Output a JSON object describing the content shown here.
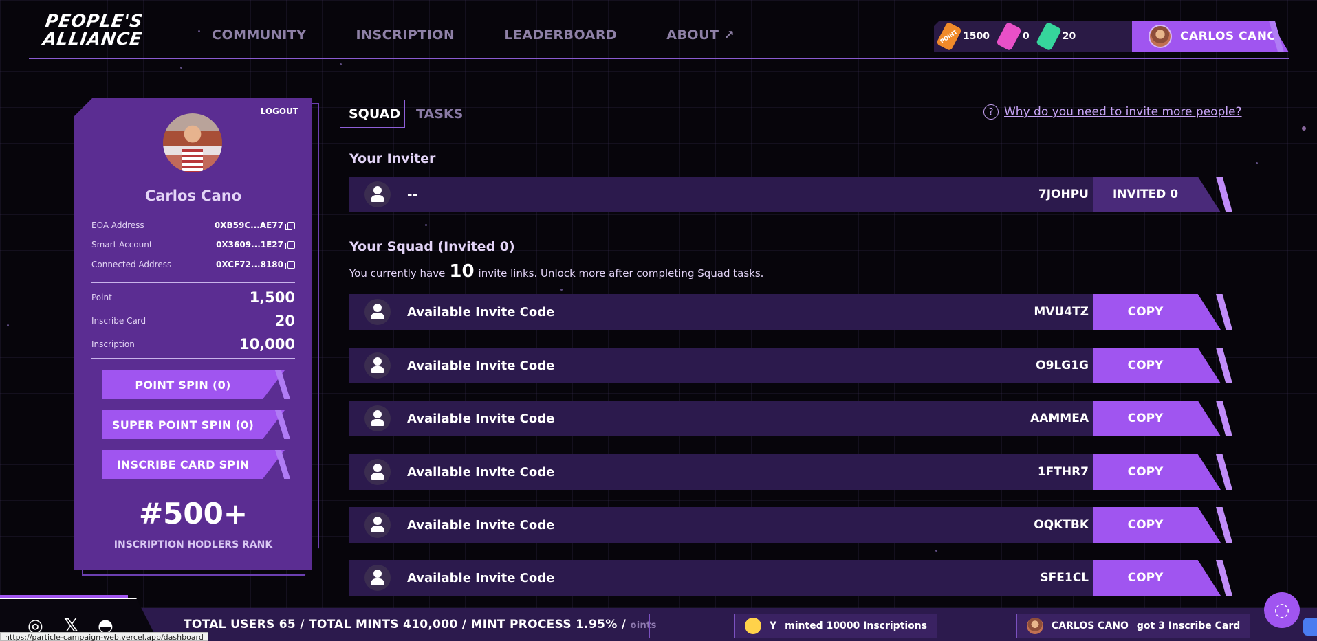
{
  "header": {
    "logo_line1": "PEOPLE'S",
    "logo_line2": "ALLIANCE",
    "nav": [
      {
        "label": "COMMUNITY"
      },
      {
        "label": "INSCRIPTION"
      },
      {
        "label": "LEADERBOARD"
      },
      {
        "label": "ABOUT",
        "suffix": "↗"
      }
    ],
    "wallet": {
      "point_ticket": "POINT",
      "point_value": "1500",
      "super_value": "0",
      "inscribe_value": "20"
    },
    "user_name": "CARLOS CANO"
  },
  "profile": {
    "logout": "LOGOUT",
    "name": "Carlos Cano",
    "eoa_label": "EOA Address",
    "eoa_value": "0XB59C...AE77",
    "smart_label": "Smart Account",
    "smart_value": "0X3609...1E27",
    "connected_label": "Connected Address",
    "connected_value": "0XCF72...8180",
    "point_label": "Point",
    "point_value": "1,500",
    "card_label": "Inscribe Card",
    "card_value": "20",
    "inscription_label": "Inscription",
    "inscription_value": "10,000",
    "btn_point_spin": "POINT SPIN (0)",
    "btn_super_spin": "SUPER POINT SPIN (0)",
    "btn_card_spin": "INSCRIBE CARD SPIN",
    "rank": "#500+",
    "rank_label": "INSCRIPTION HODLERS RANK"
  },
  "tabs": {
    "squad": "SQUAD",
    "tasks": "TASKS"
  },
  "help_link": "Why do you need to invite more people?",
  "inviter": {
    "title": "Your Inviter",
    "name": "--",
    "code": "7JOHPU",
    "button": "INVITED 0"
  },
  "squad": {
    "title": "Your Squad (Invited 0)",
    "note_prefix": "You currently have",
    "note_count": "10",
    "note_suffix": "invite links. Unlock more after completing Squad tasks.",
    "rows": [
      {
        "label": "Available Invite Code",
        "code": "MVU4TZ",
        "button": "COPY"
      },
      {
        "label": "Available Invite Code",
        "code": "O9LG1G",
        "button": "COPY"
      },
      {
        "label": "Available Invite Code",
        "code": "AAMMEA",
        "button": "COPY"
      },
      {
        "label": "Available Invite Code",
        "code": "1FTHR7",
        "button": "COPY"
      },
      {
        "label": "Available Invite Code",
        "code": "OQKTBK",
        "button": "COPY"
      },
      {
        "label": "Available Invite Code",
        "code": "SFE1CL",
        "button": "COPY"
      }
    ]
  },
  "footer": {
    "stats": "TOTAL USERS 65  /  TOTAL MINTS 410,000  /  MINT PROCESS 1.95%  /",
    "fade_text": "oints",
    "ticker1_user": "Y",
    "ticker1_text": "minted 10000 Inscriptions",
    "ticker2_user": "CARLOS CANO",
    "ticker2_text": "got 3 Inscribe Card",
    "status_url": "https://particle-campaign-web.vercel.app/dashboard"
  }
}
